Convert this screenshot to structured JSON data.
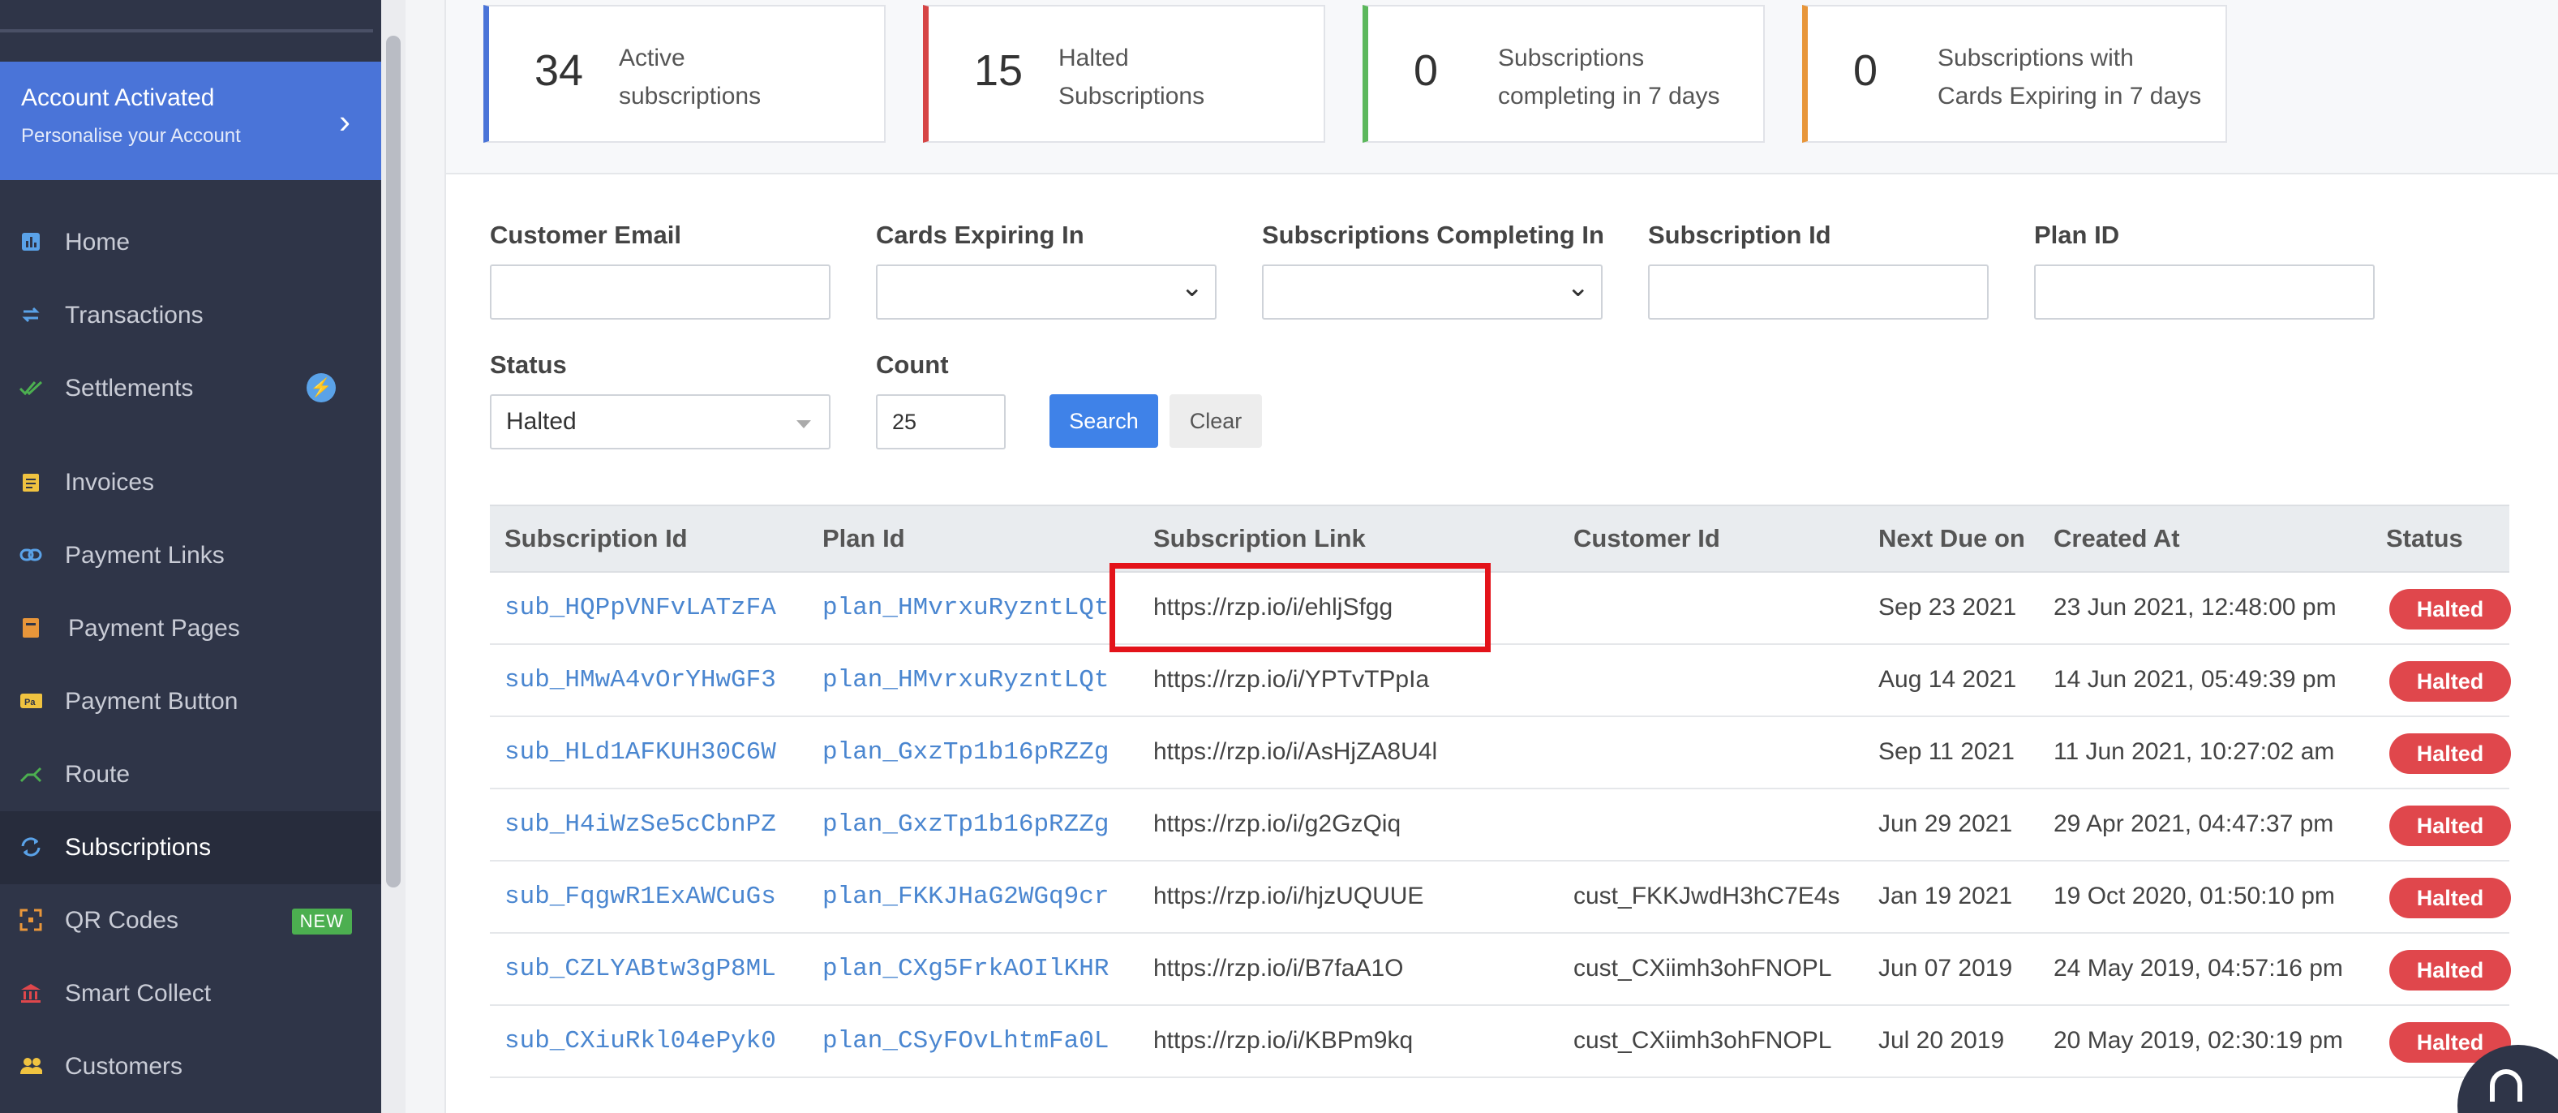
{
  "sidebar": {
    "activation": {
      "title": "Account Activated",
      "subtitle": "Personalise your Account"
    },
    "items": [
      {
        "label": "Home",
        "icon": "bar-chart-icon"
      },
      {
        "label": "Transactions",
        "icon": "swap-arrows-icon"
      },
      {
        "label": "Settlements",
        "icon": "double-check-icon"
      },
      {
        "label": "Invoices",
        "icon": "clipboard-icon"
      },
      {
        "label": "Payment Links",
        "icon": "link-icon"
      },
      {
        "label": "Payment Pages",
        "icon": "page-icon"
      },
      {
        "label": "Payment Button",
        "icon": "pay-button-icon"
      },
      {
        "label": "Route",
        "icon": "route-icon"
      },
      {
        "label": "Subscriptions",
        "icon": "refresh-icon"
      },
      {
        "label": "QR Codes",
        "icon": "qr-icon",
        "badge": "NEW"
      },
      {
        "label": "Smart Collect",
        "icon": "bank-icon"
      },
      {
        "label": "Customers",
        "icon": "users-icon"
      }
    ]
  },
  "stats": [
    {
      "value": "34",
      "line1": "Active",
      "line2": "subscriptions",
      "color": "#4a74d8"
    },
    {
      "value": "15",
      "line1": "Halted",
      "line2": "Subscriptions",
      "color": "#d64545"
    },
    {
      "value": "0",
      "line1": "Subscriptions",
      "line2": "completing in 7 days",
      "color": "#5cb85c"
    },
    {
      "value": "0",
      "line1": "Subscriptions with",
      "line2": "Cards Expiring in 7 days",
      "color": "#e8963a"
    }
  ],
  "filters": {
    "customer_email": {
      "label": "Customer Email",
      "value": ""
    },
    "cards_expiring": {
      "label": "Cards Expiring In",
      "value": ""
    },
    "subs_completing": {
      "label": "Subscriptions Completing In",
      "value": ""
    },
    "subscription_id": {
      "label": "Subscription Id",
      "value": ""
    },
    "plan_id": {
      "label": "Plan ID",
      "value": ""
    },
    "status": {
      "label": "Status",
      "value": "Halted"
    },
    "count": {
      "label": "Count",
      "value": "25"
    },
    "search_label": "Search",
    "clear_label": "Clear"
  },
  "table": {
    "headers": [
      "Subscription Id",
      "Plan Id",
      "Subscription Link",
      "Customer Id",
      "Next Due on",
      "Created At",
      "Status"
    ],
    "rows": [
      {
        "sub_id": "sub_HQPpVNFvLATzFA",
        "plan_id": "plan_HMvrxuRyzntLQt",
        "link": "https://rzp.io/i/ehljSfgg",
        "customer": "",
        "next_due": "Sep 23 2021",
        "created": "23 Jun 2021, 12:48:00 pm",
        "status": "Halted"
      },
      {
        "sub_id": "sub_HMwA4vOrYHwGF3",
        "plan_id": "plan_HMvrxuRyzntLQt",
        "link": "https://rzp.io/i/YPTvTPpIa",
        "customer": "",
        "next_due": "Aug 14 2021",
        "created": "14 Jun 2021, 05:49:39 pm",
        "status": "Halted"
      },
      {
        "sub_id": "sub_HLd1AFKUH30C6W",
        "plan_id": "plan_GxzTp1b16pRZZg",
        "link": "https://rzp.io/i/AsHjZA8U4l",
        "customer": "",
        "next_due": "Sep 11 2021",
        "created": "11 Jun 2021, 10:27:02 am",
        "status": "Halted"
      },
      {
        "sub_id": "sub_H4iWzSe5cCbnPZ",
        "plan_id": "plan_GxzTp1b16pRZZg",
        "link": "https://rzp.io/i/g2GzQiq",
        "customer": "",
        "next_due": "Jun 29 2021",
        "created": "29 Apr 2021, 04:47:37 pm",
        "status": "Halted"
      },
      {
        "sub_id": "sub_FqgwR1ExAWCuGs",
        "plan_id": "plan_FKKJHaG2WGq9cr",
        "link": "https://rzp.io/i/hjzUQUUE",
        "customer": "cust_FKKJwdH3hC7E4s",
        "next_due": "Jan 19 2021",
        "created": "19 Oct 2020, 01:50:10 pm",
        "status": "Halted"
      },
      {
        "sub_id": "sub_CZLYABtw3gP8ML",
        "plan_id": "plan_CXg5FrkAOIlKHR",
        "link": "https://rzp.io/i/B7faA1O",
        "customer": "cust_CXiimh3ohFNOPL",
        "next_due": "Jun 07 2019",
        "created": "24 May 2019, 04:57:16 pm",
        "status": "Halted"
      },
      {
        "sub_id": "sub_CXiuRkl04ePyk0",
        "plan_id": "plan_CSyFOvLhtmFa0L",
        "link": "https://rzp.io/i/KBPm9kq",
        "customer": "cust_CXiimh3ohFNOPL",
        "next_due": "Jul 20 2019",
        "created": "20 May 2019, 02:30:19 pm",
        "status": "Halted"
      }
    ]
  }
}
